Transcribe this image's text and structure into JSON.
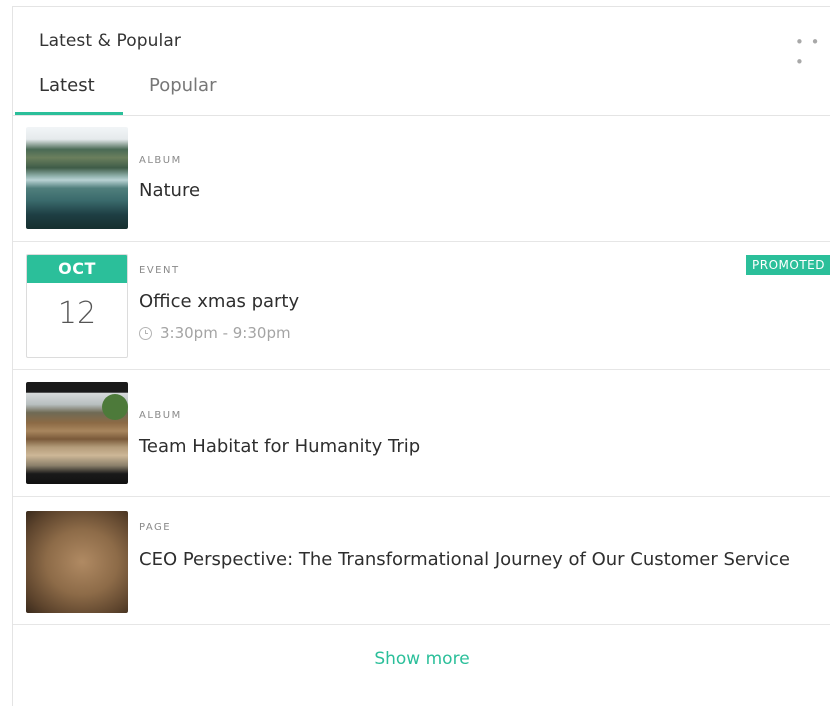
{
  "widget": {
    "title": "Latest & Popular",
    "more_icon": "more-horizontal-icon",
    "tabs": [
      {
        "label": "Latest",
        "active": true
      },
      {
        "label": "Popular",
        "active": false
      }
    ]
  },
  "items": [
    {
      "type": "ALBUM",
      "title": "Nature",
      "thumbnail": "lake-mountain-photo"
    },
    {
      "type": "EVENT",
      "title": "Office xmas party",
      "month": "OCT",
      "day": "12",
      "time": "3:30pm - 9:30pm",
      "badge": "PROMOTED"
    },
    {
      "type": "ALBUM",
      "title": "Team Habitat for Humanity Trip",
      "thumbnail": "construction-site-photo"
    },
    {
      "type": "PAGE",
      "title": "CEO Perspective: The Transformational Journey of Our Customer Service",
      "thumbnail": "textured-brown-image"
    }
  ],
  "footer": {
    "show_more": "Show more"
  },
  "colors": {
    "accent": "#2bbf9a",
    "text": "#2e2e2e",
    "muted": "#8a8a8a"
  }
}
